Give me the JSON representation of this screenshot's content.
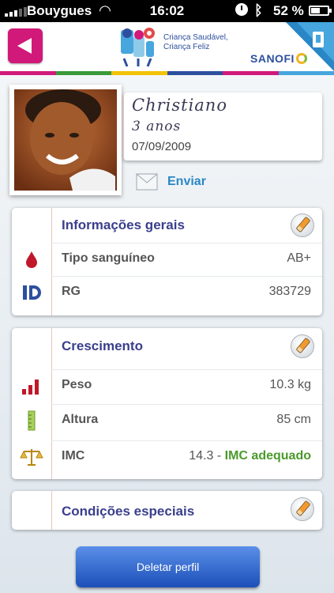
{
  "status_bar": {
    "carrier": "Bouygues",
    "time": "16:02",
    "battery": "52 %",
    "icons": [
      "signal-icon",
      "wifi-icon",
      "alarm-icon",
      "bluetooth-icon",
      "battery-icon"
    ]
  },
  "header": {
    "back_icon": "back-arrow-icon",
    "logo_line1": "Criança Saudável,",
    "logo_line2": "Criança Feliz",
    "brand": "SANOFI",
    "call_icon": "phone-icon",
    "stripe_colors": [
      "#d1197a",
      "#3a9a3a",
      "#f2c200",
      "#2d4f9e",
      "#d1197a",
      "#46a6dd"
    ]
  },
  "profile": {
    "name": "Christiano",
    "age": "3 anos",
    "birthdate": "07/09/2009",
    "send_label": "Enviar"
  },
  "general_info": {
    "title": "Informações gerais",
    "rows": [
      {
        "icon": "blood-drop-icon",
        "label": "Tipo sanguíneo",
        "value": "AB+"
      },
      {
        "icon": "id-icon",
        "label": "RG",
        "value": "383729"
      }
    ]
  },
  "growth": {
    "title": "Crescimento",
    "rows": [
      {
        "icon": "weight-bars-icon",
        "label": "Peso",
        "value": "10.3 kg"
      },
      {
        "icon": "ruler-icon",
        "label": "Altura",
        "value": "85 cm"
      }
    ],
    "imc": {
      "icon": "scale-icon",
      "label": "IMC",
      "value": "14.3",
      "sep": "-",
      "status": "IMC adequado"
    }
  },
  "special_conditions": {
    "title": "Condições especiais"
  },
  "delete_label": "Deletar perfil",
  "colors": {
    "accent": "#d1197a",
    "title": "#3a3f8c",
    "link": "#2a87c6",
    "ok": "#4a9a2b",
    "button": "#1d4fb8"
  }
}
